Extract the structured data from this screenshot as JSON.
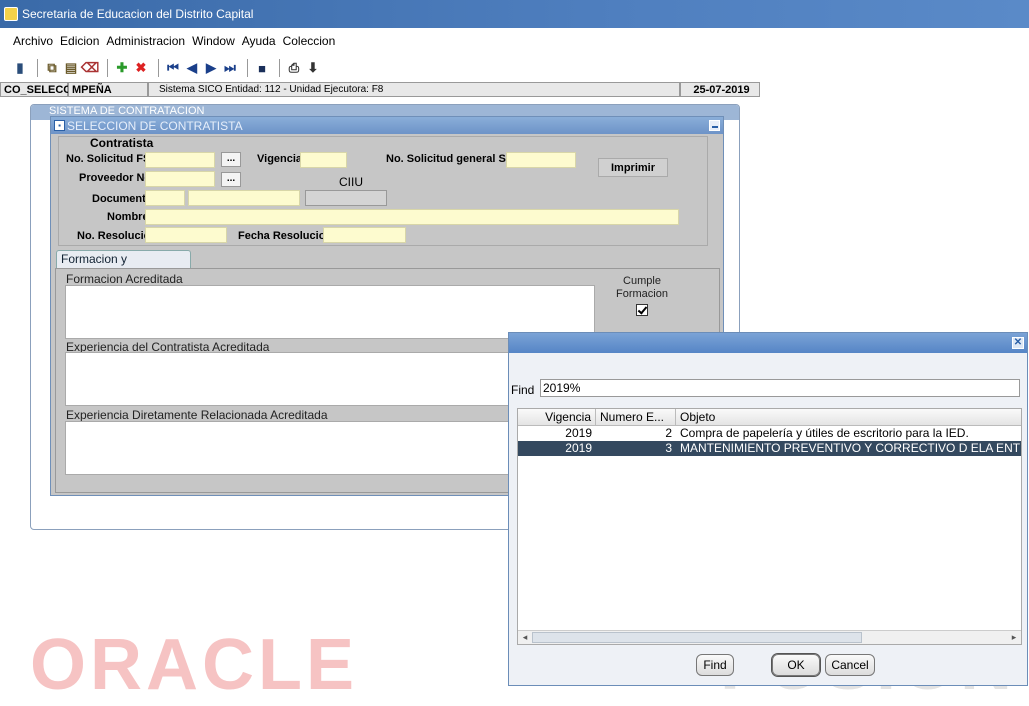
{
  "window": {
    "title": "Secretaria de Educacion del Distrito Capital"
  },
  "menu": [
    "Archivo",
    "Edicion",
    "Administracion",
    "Window",
    "Ayuda",
    "Coleccion"
  ],
  "toolbar_icons": [
    "exit-icon",
    "copy-icon",
    "paste-icon",
    "clear-icon",
    "add-record-icon",
    "delete-record-icon",
    "first-record-icon",
    "prev-record-icon",
    "next-record-icon",
    "last-record-icon",
    "save-icon",
    "print-icon",
    "download-icon"
  ],
  "status": {
    "form": "CO_SELECCIC",
    "user": "MPEÑA",
    "info": "Sistema SICO  Entidad: 112 - Unidad Ejecutora: F8",
    "date": "25-07-2019"
  },
  "outer_window": {
    "title": "SISTEMA DE CONTRATACION"
  },
  "inner_window": {
    "title": "SELECCION DE CONTRATISTA"
  },
  "form": {
    "section": "Contratista",
    "solicitud_fse_label": "No. Solicitud FSE",
    "vigencia_label": "Vigencia",
    "solicitud_general_label": "No. Solicitud general SED",
    "imprimir_label": "Imprimir",
    "proveedor_label": "Proveedor No.",
    "ciiu_label": "CIIU",
    "documento_label": "Documento",
    "nombre_label": "Nombre",
    "resolucion_label": "No. Resolucion",
    "fecha_resolucion_label": "Fecha Resolucion",
    "lookup_button": "..."
  },
  "tab": {
    "label": "Formacion y Experiencia"
  },
  "tab_content": {
    "formacion_label": "Formacion Acreditada",
    "cumple_line1": "Cumple",
    "cumple_line2": "Formacion",
    "cumple_checked": true,
    "experiencia_label": "Experiencia del Contratista Acreditada",
    "experiencia_rel_label": "Experiencia Diretamente Relacionada Acreditada"
  },
  "dialog": {
    "find_label": "Find",
    "find_value": "2019%",
    "columns": [
      "Vigencia",
      "Numero E...",
      "Objeto"
    ],
    "rows": [
      {
        "vigencia": "2019",
        "numero": "2",
        "objeto": "Compra de papelería y útiles de escritorio para la IED."
      },
      {
        "vigencia": "2019",
        "numero": "3",
        "objeto": "MANTENIMIENTO PREVENTIVO Y CORRECTIVO D ELA ENTIDAD"
      }
    ],
    "selected_row": 1,
    "find_button": "Find",
    "ok_button": "OK",
    "cancel_button": "Cancel"
  },
  "watermark": {
    "left": "ORACLE",
    "right": "FUSION"
  }
}
